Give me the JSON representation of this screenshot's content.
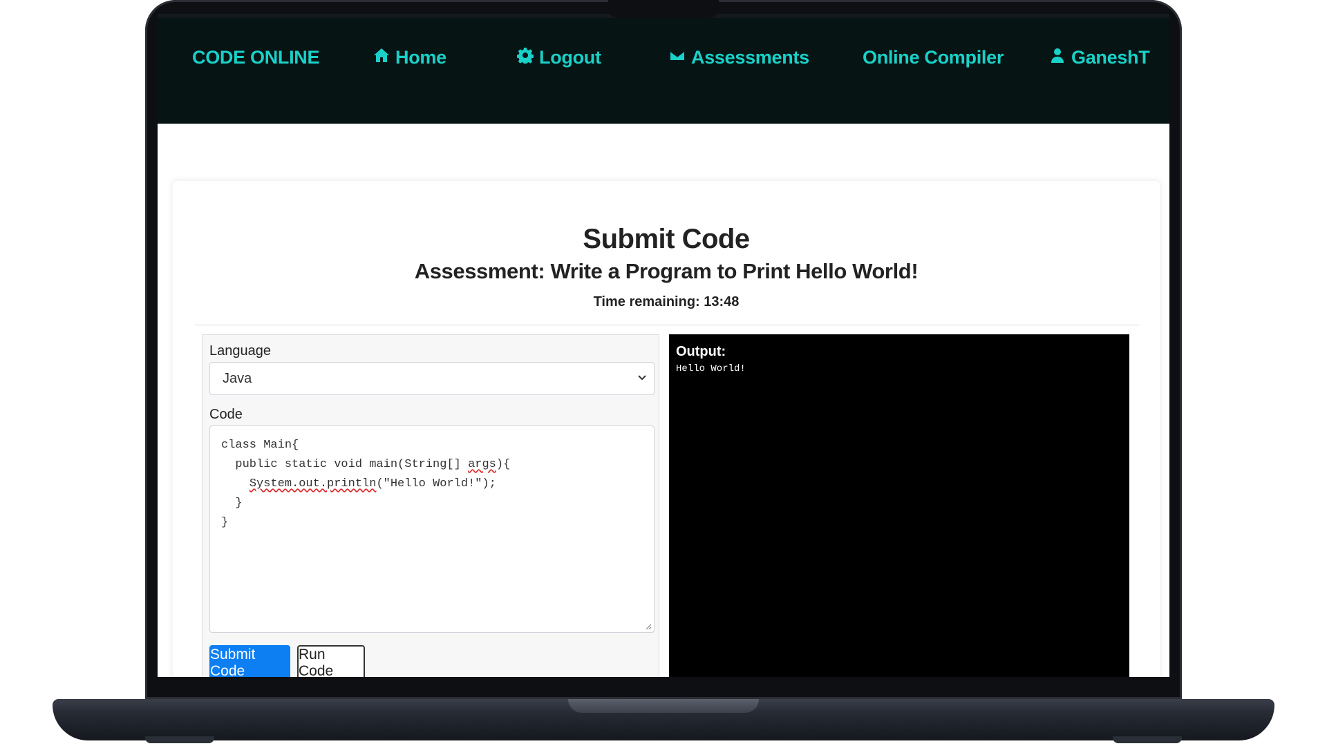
{
  "nav": {
    "brand": "CODE ONLINE",
    "home": "Home",
    "logout": "Logout",
    "assessments": "Assessments",
    "compiler": "Online Compiler",
    "user": "GaneshT"
  },
  "page": {
    "title": "Submit Code",
    "assessment": "Assessment: Write a Program to Print Hello World!",
    "timer": "Time remaining: 13:48"
  },
  "form": {
    "language_label": "Language",
    "language_value": "Java",
    "code_label": "Code",
    "code_lines": [
      "class Main{",
      "  public static void main(String[] args){",
      "    System.out.println(\"Hello World!\");",
      "  }",
      "}"
    ],
    "submit_label": "Submit Code",
    "run_label": "Run Code"
  },
  "output": {
    "label": "Output:",
    "text": "Hello World!"
  },
  "colors": {
    "nav_bg": "#071414",
    "nav_accent": "#19d1c8",
    "primary_button": "#0d7ff2",
    "output_bg": "#000000"
  },
  "icons": [
    "home-icon",
    "gear-icon",
    "envelope-icon",
    "user-icon"
  ]
}
